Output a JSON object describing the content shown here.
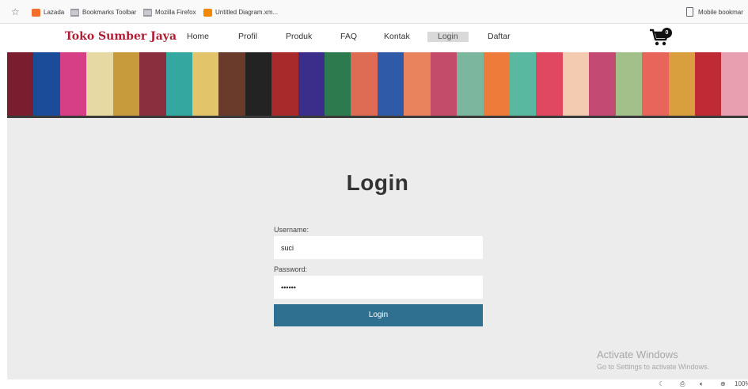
{
  "bookmarks": {
    "items": [
      {
        "label": "Lazada",
        "icon": "lazada-icon"
      },
      {
        "label": "Bookmarks Toolbar",
        "icon": "folder-icon"
      },
      {
        "label": "Mozilla Firefox",
        "icon": "folder-icon"
      },
      {
        "label": "Untitled Diagram.xm...",
        "icon": "diagram-icon"
      }
    ],
    "mobile_label": "Mobile bookmar"
  },
  "site": {
    "brand": "Toko Sumber Jaya",
    "nav": [
      {
        "label": "Home"
      },
      {
        "label": "Profil"
      },
      {
        "label": "Produk"
      },
      {
        "label": "FAQ"
      },
      {
        "label": "Kontak"
      },
      {
        "label": "Login",
        "active": true
      },
      {
        "label": "Daftar"
      }
    ],
    "cart_count": "0",
    "accent_color": "#b01c33"
  },
  "login": {
    "title": "Login",
    "username_label": "Username:",
    "username_value": "suci",
    "password_label": "Password:",
    "password_value": "••••••",
    "button_label": "Login",
    "button_color": "#2f6f8f"
  },
  "watermark": {
    "title": "Activate Windows",
    "subtitle": "Go to Settings to activate Windows."
  },
  "statusbar": {
    "zoom": "100%"
  }
}
